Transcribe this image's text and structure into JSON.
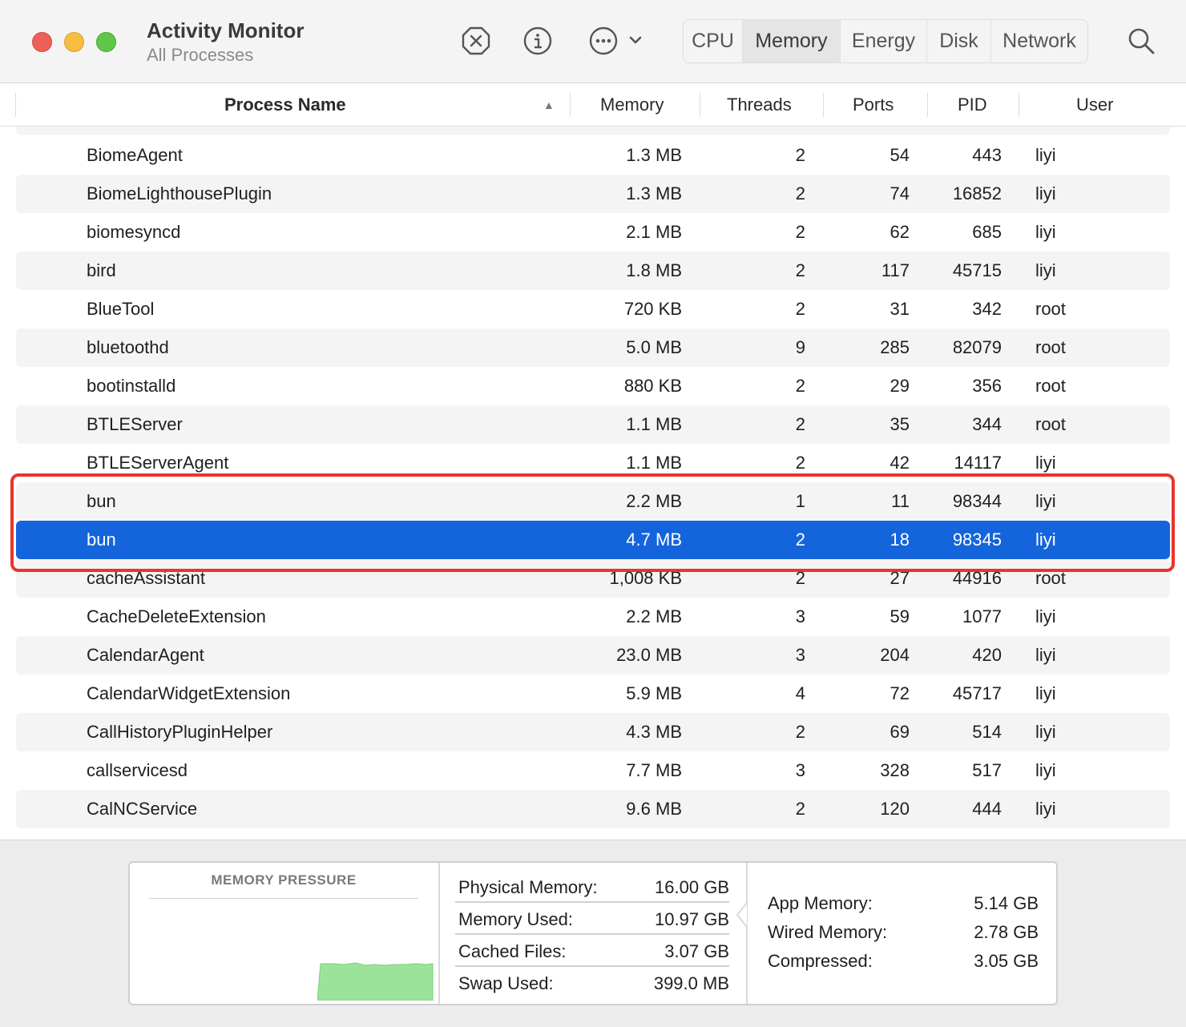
{
  "window": {
    "title": "Activity Monitor",
    "subtitle": "All Processes"
  },
  "toolbar": {
    "icons": [
      "stop-process-icon",
      "info-icon",
      "more-actions-icon"
    ],
    "tabs": [
      {
        "label": "CPU",
        "active": false
      },
      {
        "label": "Memory",
        "active": true
      },
      {
        "label": "Energy",
        "active": false
      },
      {
        "label": "Disk",
        "active": false
      },
      {
        "label": "Network",
        "active": false
      }
    ],
    "search_icon": "search-icon"
  },
  "table": {
    "columns": {
      "name": "Process Name",
      "memory": "Memory",
      "threads": "Threads",
      "ports": "Ports",
      "pid": "PID",
      "user": "User"
    },
    "sort_indicator": "▲",
    "rows": [
      {
        "name": "BiomeAgent",
        "memory": "1.3 MB",
        "threads": "2",
        "ports": "54",
        "pid": "443",
        "user": "liyi"
      },
      {
        "name": "BiomeLighthousePlugin",
        "memory": "1.3 MB",
        "threads": "2",
        "ports": "74",
        "pid": "16852",
        "user": "liyi"
      },
      {
        "name": "biomesyncd",
        "memory": "2.1 MB",
        "threads": "2",
        "ports": "62",
        "pid": "685",
        "user": "liyi"
      },
      {
        "name": "bird",
        "memory": "1.8 MB",
        "threads": "2",
        "ports": "117",
        "pid": "45715",
        "user": "liyi"
      },
      {
        "name": "BlueTool",
        "memory": "720 KB",
        "threads": "2",
        "ports": "31",
        "pid": "342",
        "user": "root"
      },
      {
        "name": "bluetoothd",
        "memory": "5.0 MB",
        "threads": "9",
        "ports": "285",
        "pid": "82079",
        "user": "root"
      },
      {
        "name": "bootinstalld",
        "memory": "880 KB",
        "threads": "2",
        "ports": "29",
        "pid": "356",
        "user": "root"
      },
      {
        "name": "BTLEServer",
        "memory": "1.1 MB",
        "threads": "2",
        "ports": "35",
        "pid": "344",
        "user": "root"
      },
      {
        "name": "BTLEServerAgent",
        "memory": "1.1 MB",
        "threads": "2",
        "ports": "42",
        "pid": "14117",
        "user": "liyi"
      },
      {
        "name": "bun",
        "memory": "2.2 MB",
        "threads": "1",
        "ports": "11",
        "pid": "98344",
        "user": "liyi"
      },
      {
        "name": "bun",
        "memory": "4.7 MB",
        "threads": "2",
        "ports": "18",
        "pid": "98345",
        "user": "liyi",
        "selected": true
      },
      {
        "name": "cacheAssistant",
        "memory": "1,008 KB",
        "threads": "2",
        "ports": "27",
        "pid": "44916",
        "user": "root"
      },
      {
        "name": "CacheDeleteExtension",
        "memory": "2.2 MB",
        "threads": "3",
        "ports": "59",
        "pid": "1077",
        "user": "liyi"
      },
      {
        "name": "CalendarAgent",
        "memory": "23.0 MB",
        "threads": "3",
        "ports": "204",
        "pid": "420",
        "user": "liyi"
      },
      {
        "name": "CalendarWidgetExtension",
        "memory": "5.9 MB",
        "threads": "4",
        "ports": "72",
        "pid": "45717",
        "user": "liyi"
      },
      {
        "name": "CallHistoryPluginHelper",
        "memory": "4.3 MB",
        "threads": "2",
        "ports": "69",
        "pid": "514",
        "user": "liyi"
      },
      {
        "name": "callservicesd",
        "memory": "7.7 MB",
        "threads": "3",
        "ports": "328",
        "pid": "517",
        "user": "liyi"
      },
      {
        "name": "CalNCService",
        "memory": "9.6 MB",
        "threads": "2",
        "ports": "120",
        "pid": "444",
        "user": "liyi"
      }
    ]
  },
  "summary": {
    "pressure_label": "MEMORY PRESSURE",
    "pressure_color": "#9be39b",
    "stats": [
      {
        "label": "Physical Memory:",
        "value": "16.00 GB"
      },
      {
        "label": "Memory Used:",
        "value": "10.97 GB"
      },
      {
        "label": "Cached Files:",
        "value": "3.07 GB"
      },
      {
        "label": "Swap Used:",
        "value": "399.0 MB"
      }
    ],
    "breakdown": [
      {
        "label": "App Memory:",
        "value": "5.14 GB"
      },
      {
        "label": "Wired Memory:",
        "value": "2.78 GB"
      },
      {
        "label": "Compressed:",
        "value": "3.05 GB"
      }
    ]
  },
  "colors": {
    "selection": "#1464dc",
    "highlight_box": "#e8352e"
  }
}
